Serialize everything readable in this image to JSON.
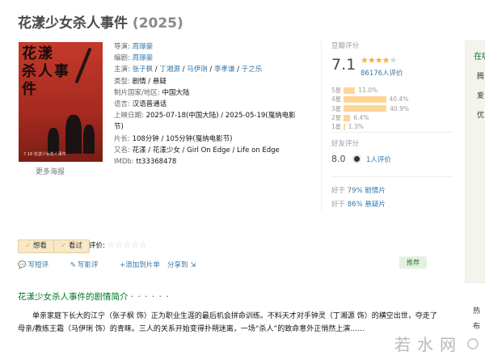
{
  "title": {
    "name": "花漾少女杀人事件",
    "year": "(2025)"
  },
  "poster": {
    "glyph_text": "花漾杀人事件",
    "caption": "7.18 花漾少女杀人事件",
    "more_label": "更多海报"
  },
  "info": [
    {
      "key": "导演",
      "sep": ": ",
      "links": [
        "周璟豪"
      ]
    },
    {
      "key": "编剧",
      "sep": ": ",
      "links": [
        "周璟豪"
      ]
    },
    {
      "key": "主演",
      "sep": ": ",
      "links": [
        "张子枫",
        "丁湘源",
        "马伊琍",
        "李孝谦",
        "于之乐"
      ]
    },
    {
      "key": "类型",
      "sep": ": ",
      "text": "剧情 / 悬疑"
    },
    {
      "key": "制片国家/地区",
      "sep": ": ",
      "text": "中国大陆"
    },
    {
      "key": "语言",
      "sep": ": ",
      "text": "汉语普通话"
    },
    {
      "key": "上映日期",
      "sep": ": ",
      "text": "2025-07-18(中国大陆) / 2025-05-19(戛纳电影"
    },
    {
      "key": "",
      "sep": "",
      "text": "节)"
    },
    {
      "key": "片长",
      "sep": ": ",
      "text": "108分钟 / 105分钟(戛纳电影节)"
    },
    {
      "key": "又名",
      "sep": ": ",
      "text": "花漾 / 花漾少女 / Girl On Edge / Life on Edge"
    },
    {
      "key": "IMDb",
      "sep": ": ",
      "text": "tt33368478"
    }
  ],
  "rating": {
    "label": "豆瓣评分",
    "score": "7.1",
    "stars_on": "★★★★",
    "stars_off": "★",
    "count": "86176人评价",
    "bars": [
      {
        "label": "5星",
        "percent": "11.0%",
        "value": 11.0
      },
      {
        "label": "4星",
        "percent": "40.4%",
        "value": 40.4
      },
      {
        "label": "3星",
        "percent": "40.9%",
        "value": 40.9
      },
      {
        "label": "2星",
        "percent": "6.4%",
        "value": 6.4
      },
      {
        "label": "1星",
        "percent": "1.3%",
        "value": 1.3
      }
    ],
    "friend_label": "好友评分",
    "friend_score": "8.0",
    "friend_count": "1人评价",
    "better1_prefix": "好于",
    "better1_link": "79% 剧情片",
    "better2_prefix": "好于",
    "better2_link": "86% 悬疑片"
  },
  "side": {
    "header": "在哪儿看",
    "items": [
      "腾",
      "爱",
      "优"
    ],
    "bottom": [
      "热",
      "布"
    ]
  },
  "actions": {
    "want": "想看",
    "seen": "看过",
    "rate_label": "评价:",
    "rate_stars": "☆☆☆☆☆",
    "short_review": "写短评",
    "long_review": "写影评",
    "add_list": "+添加到片单",
    "share": "分享到",
    "recommend": "推荐"
  },
  "synopsis": {
    "title": "花漾少女杀人事件的剧情简介",
    "dots": "· · · · · ·",
    "text": "单亲家庭下长大的江宁（张子枫 饰）正为职业生涯的最后机会拼命训练。不料天才对手钟灵（丁湘源 饰）的横空出世，夺走了母亲/教练王霜（马伊琍 饰）的青睐。三人的关系开始变得扑朔迷离，一场“杀人”的致命意外正悄然上演……"
  },
  "watermark": "若水网",
  "colors": {
    "link": "#3377aa",
    "green": "#007722",
    "star": "#ffac2d",
    "bar": "#ffd596"
  }
}
